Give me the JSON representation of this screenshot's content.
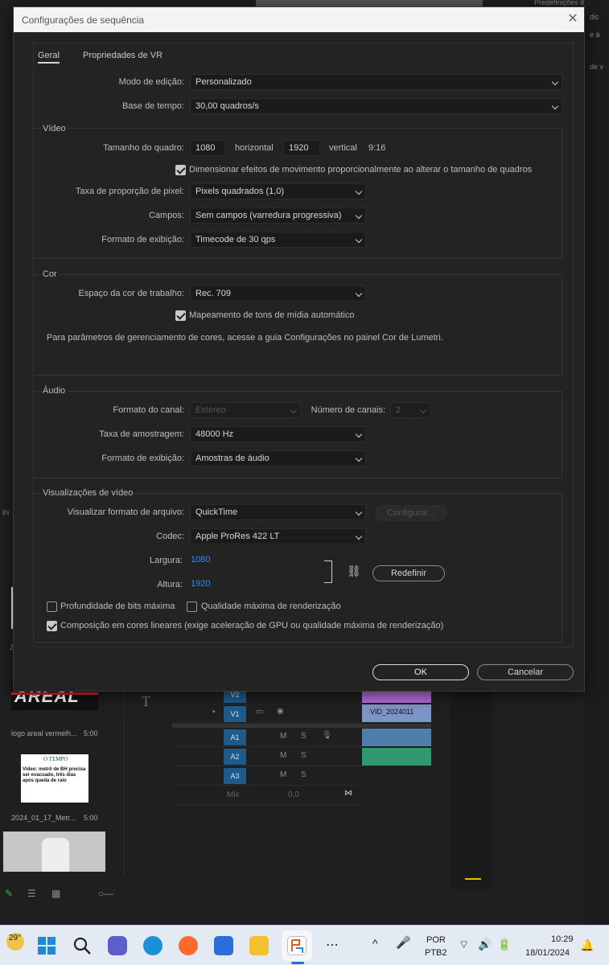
{
  "background": {
    "logo_text": "AREAL",
    "clip1_label": "logo areal vermelh...",
    "clip1_duration": "5:00",
    "clip2_label": "2024_01_17_Metr...",
    "clip2_duration": "5:00",
    "news_brand": "O TEMPO",
    "news_headline": "Vídeo: metrô de BH precisa ser evacuado, três dias após queda de raio",
    "tracks": {
      "v2": "V2",
      "v1": "V1",
      "a1": "A1",
      "a2": "A2",
      "a3": "A3",
      "mix": "Mix",
      "mix_value": "0,0",
      "v1_clip": "VID_2024011"
    },
    "side_texts": [
      "Predefinições d",
      "dic",
      "e á",
      "de v",
      "Pr",
      "2"
    ]
  },
  "dialog": {
    "title": "Configurações de sequência",
    "tabs": [
      {
        "label": "Geral",
        "active": true
      },
      {
        "label": "Propriedades de VR",
        "active": false
      }
    ],
    "editing_mode": {
      "label": "Modo de edição:",
      "value": "Personalizado"
    },
    "timebase": {
      "label": "Base de tempo:",
      "value": "30,00  quadros/s"
    },
    "video": {
      "title": "Vídeo",
      "frame_size_label": "Tamanho do quadro:",
      "width_value": "1080",
      "horizontal_label": "horizontal",
      "height_value": "1920",
      "vertical_label": "vertical",
      "aspect": "9:16",
      "scale_checkbox": {
        "label": "Dimensionar efeitos de movimento proporcionalmente ao alterar o tamanho de quadros",
        "checked": true
      },
      "pixel_aspect": {
        "label": "Taxa de proporção de pixel:",
        "value": "Pixels quadrados (1,0)"
      },
      "fields": {
        "label": "Campos:",
        "value": "Sem campos (varredura progressiva)"
      },
      "display_format": {
        "label": "Formato de exibição:",
        "value": "Timecode de 30 qps"
      }
    },
    "color": {
      "title": "Cor",
      "working_space": {
        "label": "Espaço da cor de trabalho:",
        "value": "Rec. 709"
      },
      "tone_mapping": {
        "label": "Mapeamento de tons de mídia automático",
        "checked": true
      },
      "note": "Para parâmetros de gerenciamento de cores, acesse a guia Configurações no painel Cor de Lumetri."
    },
    "audio": {
      "title": "Áudio",
      "channel_format": {
        "label": "Formato do canal:",
        "value": "Estéreo"
      },
      "num_channels": {
        "label": "Número de canais:",
        "value": "2"
      },
      "sample_rate": {
        "label": "Taxa de amostragem:",
        "value": "48000 Hz"
      },
      "display_format": {
        "label": "Formato de exibição:",
        "value": "Amostras de áudio"
      }
    },
    "previews": {
      "title": "Visualizações de vídeo",
      "file_format": {
        "label": "Visualizar formato de arquivo:",
        "value": "QuickTime"
      },
      "configure_label": "Configurar...",
      "codec": {
        "label": "Codec:",
        "value": "Apple ProRes 422 LT"
      },
      "width": {
        "label": "Largura:",
        "value": "1080"
      },
      "height": {
        "label": "Altura:",
        "value": "1920"
      },
      "reset_label": "Redefinir",
      "max_bit_depth": {
        "label": "Profundidade de bits máxima",
        "checked": false
      },
      "max_render_quality": {
        "label": "Qualidade máxima de renderização",
        "checked": false
      },
      "linear_compositing": {
        "label": "Composição em cores lineares (exige aceleração de GPU ou qualidade máxima de renderização)",
        "checked": true
      }
    },
    "ok_label": "OK",
    "cancel_label": "Cancelar"
  },
  "taskbar": {
    "weather_temp": "29°",
    "lang_line1": "POR",
    "lang_line2": "PTB2",
    "time": "10:29",
    "date": "18/01/2024",
    "apps": [
      "start-icon",
      "search-icon",
      "chat-icon",
      "edge-icon",
      "firefox-icon",
      "store-icon",
      "explorer-icon",
      "premiere-icon",
      "more-icon"
    ]
  },
  "colors": {
    "dialog_bg": "#232323",
    "link_blue": "#2d8ceb",
    "track_blue": "#1f5b8a",
    "taskbar_bg": "#e4eaf3"
  }
}
